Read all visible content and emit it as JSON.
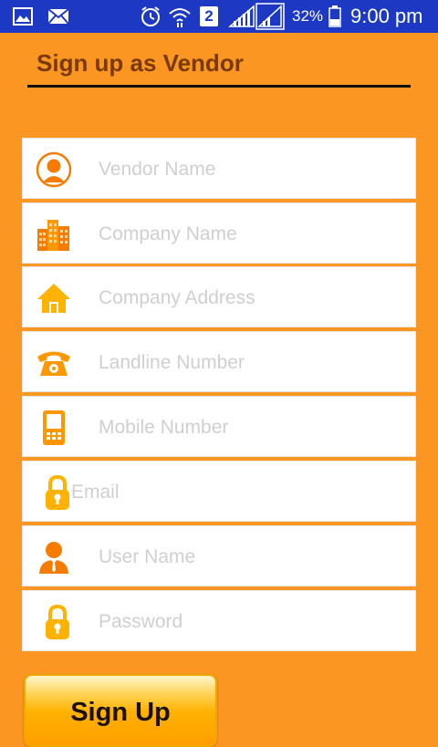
{
  "status_bar": {
    "battery_percent": "32%",
    "time": "9:00 pm",
    "sim_badge": "2",
    "icons": [
      "image-notification-icon",
      "mail-icon",
      "alarm-icon",
      "wifi-icon",
      "sim-2-icon",
      "signal-icon",
      "signal-icon-2",
      "battery-icon"
    ]
  },
  "page": {
    "title": "Sign up as Vendor"
  },
  "form": {
    "fields": [
      {
        "placeholder": "Vendor Name",
        "icon": "person-circle-icon"
      },
      {
        "placeholder": "Company Name",
        "icon": "buildings-icon"
      },
      {
        "placeholder": "Company Address",
        "icon": "home-icon"
      },
      {
        "placeholder": "Landline Number",
        "icon": "telephone-icon"
      },
      {
        "placeholder": "Mobile Number",
        "icon": "mobile-phone-icon"
      },
      {
        "placeholder": "Email",
        "icon": "lock-icon"
      },
      {
        "placeholder": "User Name",
        "icon": "user-icon"
      },
      {
        "placeholder": "Password",
        "icon": "lock-icon"
      }
    ]
  },
  "actions": {
    "signup_label": "Sign Up"
  },
  "colors": {
    "background": "#fb9623",
    "status_bar": "#1d39c3",
    "title": "#7a3a06",
    "icon_orange": "#fb8c00",
    "icon_yellow": "#ffb300",
    "placeholder": "#cfcfcf"
  }
}
